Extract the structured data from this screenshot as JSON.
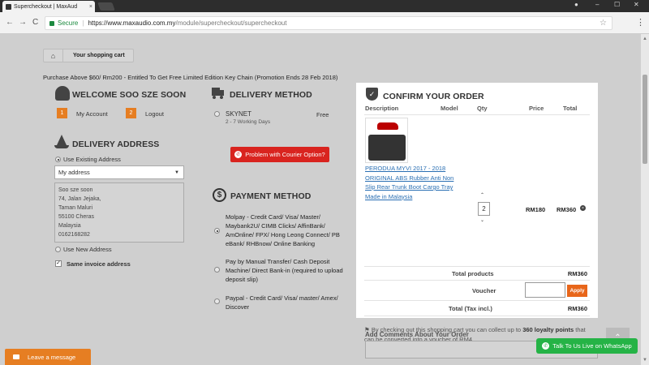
{
  "browser": {
    "tab_title": "Supercheckout | MaxAud",
    "tab_close": "×",
    "window_controls": [
      "–",
      "☐",
      "✕"
    ],
    "nav": [
      "←",
      "→",
      "C"
    ],
    "secure_label": "Secure",
    "url_host": "https://www.maxaudio.com.my",
    "url_path": "/module/supercheckout/supercheckout",
    "star": "☆",
    "menu": "⋮"
  },
  "breadcrumb": {
    "home_icon": "⌂",
    "current": "Your shopping cart"
  },
  "promo": "Purchase Above $60/ Rm200 - Entitled To Get Free Limited Edition Key Chain (Promotion Ends 28 Feb 2018)",
  "welcome": {
    "title": "WELCOME SOO SZE SOON",
    "account_num": "1",
    "account_label": "My Account",
    "logout_num": "2",
    "logout_label": "Logout"
  },
  "delivery_address": {
    "title": "DELIVERY ADDRESS",
    "use_existing": "Use Existing Address",
    "select_value": "My address",
    "address_lines": [
      "Soo sze soon",
      "74, Jalan Jejaka,",
      "Taman Maluri",
      "55100 Cheras",
      "Malaysia",
      "0162168282"
    ],
    "use_new": "Use New Address",
    "same_invoice": "Same invoice address",
    "check_mark": "✓"
  },
  "delivery_method": {
    "title": "DELIVERY METHOD",
    "carrier": "SKYNET",
    "carrier_sub": "2 - 7 Working Days",
    "price": "Free",
    "courier_btn": "Problem with Courier Option?"
  },
  "payment_method": {
    "title": "PAYMENT METHOD",
    "icon": "$",
    "options": [
      "Molpay - Credit Card/ Visa/ Master/ Maybank2U/ CIMB Clicks/ AffinBank/ AmOnline/ FPX/ Hong Leong Connect/ PB eBank/ RHBnow/ Online Banking",
      "Pay by Manual Transfer/ Cash Deposit Machine/ Direct Bank-in (required to upload deposit slip)",
      "Paypal - Credit Card/ Visa/ master/ Amex/ Discover"
    ]
  },
  "confirm": {
    "title": "CONFIRM YOUR ORDER",
    "headers": [
      "Description",
      "Model",
      "Qty",
      "Price",
      "Total"
    ],
    "product_name": "PERODUA MYVI 2017 - 2018 ORIGINAL ABS Rubber Anti Non Slip Rear Trunk Boot Cargo Tray Made in Malaysia",
    "qty": "2",
    "up": "⌃",
    "down": "⌄",
    "price": "RM180",
    "total": "RM360",
    "remove": "×",
    "total_products_label": "Total products",
    "total_products_value": "RM360",
    "voucher_label": "Voucher",
    "apply": "Apply",
    "total_tax_label": "Total (Tax incl.)",
    "total_tax_value": "RM360",
    "loyalty_flag": "⚑",
    "loyalty_pre": "By checking out this shopping cart you can collect up to",
    "loyalty_points": "360 loyalty points",
    "loyalty_post": "that can be converted into a voucher of RM4."
  },
  "comments": {
    "title": "Add Comments About Your Order"
  },
  "widgets": {
    "leave_message": "Leave a message",
    "whatsapp": "Talk To Us Live on WhatsApp",
    "to_top": "⌃"
  },
  "colors": {
    "orange": "#e67e22",
    "red": "#d9241f",
    "green": "#25b346",
    "link": "#2a6fb3"
  }
}
